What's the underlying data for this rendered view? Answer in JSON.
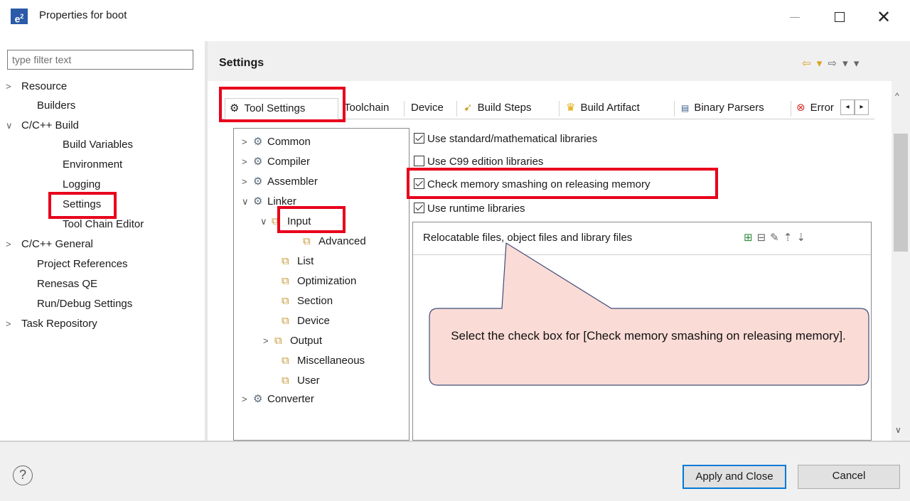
{
  "window": {
    "icon_text": "e",
    "icon_sup": "2",
    "title": "Properties for boot",
    "close_glyph": "✕"
  },
  "filter": {
    "placeholder": "type filter text"
  },
  "nav": {
    "items": [
      {
        "label": "Resource",
        "chevron": ">"
      },
      {
        "label": "Builders"
      },
      {
        "label": "C/C++ Build",
        "chevron": "∨"
      },
      {
        "label": "Build Variables"
      },
      {
        "label": "Environment"
      },
      {
        "label": "Logging"
      },
      {
        "label": "Settings"
      },
      {
        "label": "Tool Chain Editor"
      },
      {
        "label": "C/C++ General",
        "chevron": ">"
      },
      {
        "label": "Project References"
      },
      {
        "label": "Renesas QE"
      },
      {
        "label": "Run/Debug Settings"
      },
      {
        "label": "Task Repository",
        "chevron": ">"
      }
    ]
  },
  "settings": {
    "title": "Settings",
    "nav_back": "⇦ ▾",
    "nav_forward": "⇨ ▾ ▾"
  },
  "tabs": [
    {
      "label": "Tool Settings",
      "icon": "gear-icon"
    },
    {
      "label": "Toolchain",
      "icon": ""
    },
    {
      "label": "Device",
      "icon": ""
    },
    {
      "label": "Build Steps",
      "icon": "build-steps-icon"
    },
    {
      "label": "Build Artifact",
      "icon": "trophy-icon"
    },
    {
      "label": "Binary Parsers",
      "icon": "binary-icon"
    },
    {
      "label": "Error",
      "icon": "error-icon"
    }
  ],
  "tab_scroll": {
    "left": "◂",
    "right": "▸"
  },
  "scroll": {
    "up": "^",
    "down": "∨"
  },
  "tool_tree": [
    {
      "label": "Common",
      "chevron": ">"
    },
    {
      "label": "Compiler",
      "chevron": ">"
    },
    {
      "label": "Assembler",
      "chevron": ">"
    },
    {
      "label": "Linker",
      "chevron": "∨"
    },
    {
      "label": "Input",
      "chevron": "∨"
    },
    {
      "label": "Advanced"
    },
    {
      "label": "List"
    },
    {
      "label": "Optimization"
    },
    {
      "label": "Section"
    },
    {
      "label": "Device"
    },
    {
      "label": "Output",
      "chevron": ">"
    },
    {
      "label": "Miscellaneous"
    },
    {
      "label": "User"
    },
    {
      "label": "Converter",
      "chevron": ">"
    }
  ],
  "options": [
    {
      "label": "Use standard/mathematical libraries",
      "checked": true
    },
    {
      "label": "Use C99 edition libraries",
      "checked": false
    },
    {
      "label": "Check memory smashing on releasing memory",
      "checked": true
    },
    {
      "label": "Use runtime libraries",
      "checked": true
    }
  ],
  "files_panel": {
    "label": "Relocatable files, object files and library files",
    "icons": [
      "add-file-icon",
      "delete-file-icon",
      "edit-file-icon",
      "move-up-icon",
      "move-down-icon"
    ]
  },
  "callout": {
    "text": "Select the check box for [Check memory smashing on releasing memory].",
    "fill": "#fadbd6",
    "stroke": "#3c4d7a"
  },
  "highlight_color": "#e8001c",
  "buttons": {
    "apply_close": "Apply and Close",
    "cancel": "Cancel",
    "help": "?"
  }
}
